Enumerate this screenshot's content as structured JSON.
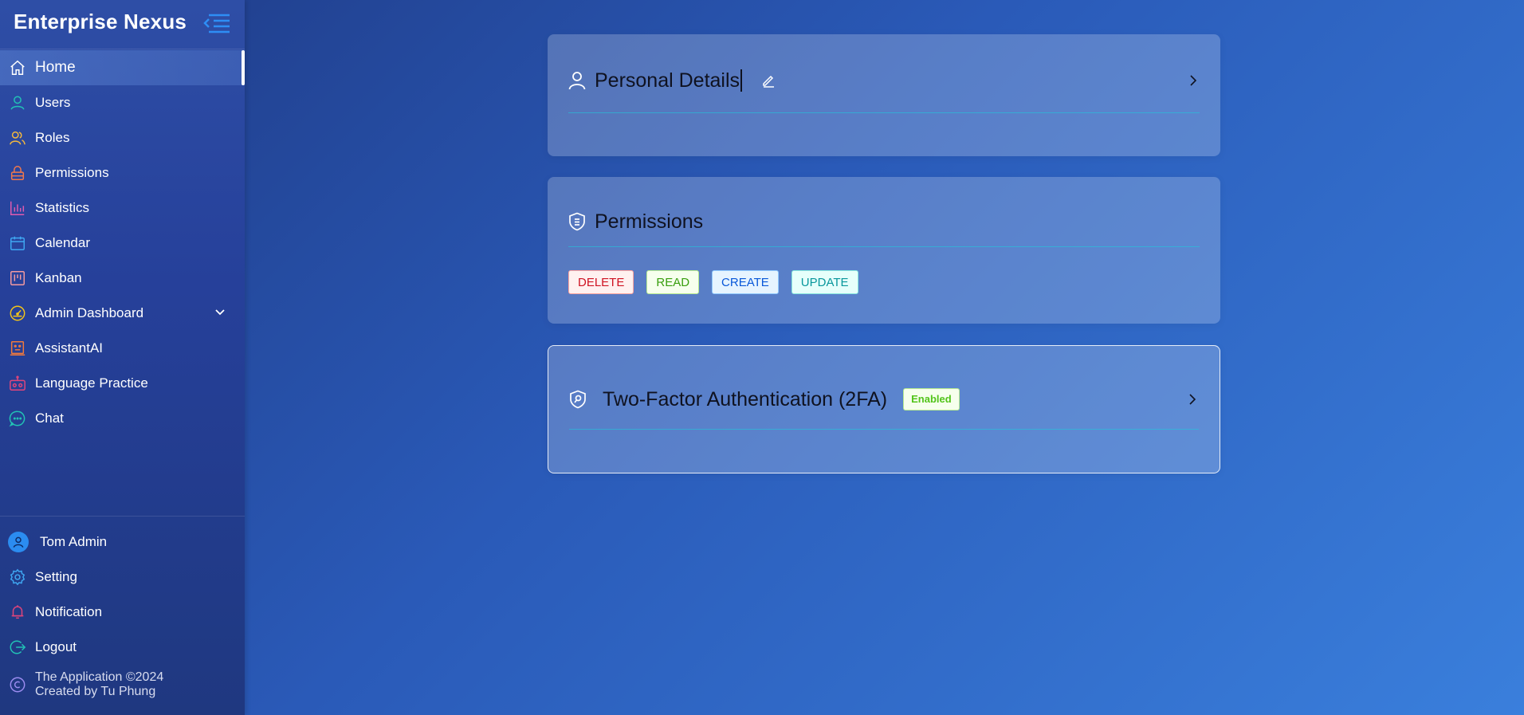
{
  "app": {
    "brand": "Enterprise Nexus"
  },
  "sidebar": {
    "items": [
      {
        "label": "Home",
        "icon": "home-icon",
        "color": "#ffffff",
        "active": true
      },
      {
        "label": "Users",
        "icon": "user-icon",
        "color": "#22c3b5"
      },
      {
        "label": "Roles",
        "icon": "users-icon",
        "color": "#f5b93d"
      },
      {
        "label": "Permissions",
        "icon": "lock-icon",
        "color": "#f2784b"
      },
      {
        "label": "Statistics",
        "icon": "bar-chart-icon",
        "color": "#e05bb0"
      },
      {
        "label": "Calendar",
        "icon": "calendar-icon",
        "color": "#3fa7f2"
      },
      {
        "label": "Kanban",
        "icon": "kanban-icon",
        "color": "#f49aa0"
      },
      {
        "label": "Admin Dashboard",
        "icon": "dashboard-icon",
        "color": "#f5c518"
      },
      {
        "label": "AssistantAI",
        "icon": "assistant-icon",
        "color": "#f27a3d"
      },
      {
        "label": "Language Practice",
        "icon": "robot-icon",
        "color": "#e0457b"
      },
      {
        "label": "Chat",
        "icon": "chat-icon",
        "color": "#22c3b5"
      }
    ],
    "bottom": [
      {
        "label": "Tom Admin",
        "icon": "avatar-icon",
        "color": "#2b8cf0"
      },
      {
        "label": "Setting",
        "icon": "gear-icon",
        "color": "#3fa7f2"
      },
      {
        "label": "Notification",
        "icon": "bell-icon",
        "color": "#e0457b"
      },
      {
        "label": "Logout",
        "icon": "logout-icon",
        "color": "#22c3b5"
      }
    ],
    "footer": {
      "line1": "The Application ©2024",
      "line2": "Created by Tu Phung",
      "icon": "copyright-icon"
    }
  },
  "main": {
    "personal": {
      "title": "Personal Details"
    },
    "permissions": {
      "title": "Permissions",
      "tags": [
        "DELETE",
        "READ",
        "CREATE",
        "UPDATE"
      ]
    },
    "twofa": {
      "title": "Two-Factor Authentication (2FA)",
      "status": "Enabled"
    }
  }
}
